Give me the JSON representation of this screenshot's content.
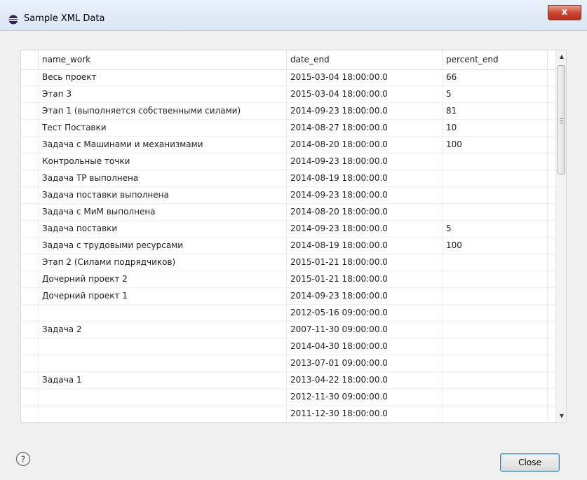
{
  "window": {
    "title": "Sample XML Data",
    "close_glyph": "x"
  },
  "table": {
    "columns": [
      "name_work",
      "date_end",
      "percent_end"
    ],
    "rows": [
      {
        "name_work": "Весь проект",
        "date_end": "2015-03-04 18:00:00.0",
        "percent_end": "66"
      },
      {
        "name_work": "Этап 3",
        "date_end": "2015-03-04 18:00:00.0",
        "percent_end": "5"
      },
      {
        "name_work": "Этап 1 (выполняется собственными силами)",
        "date_end": "2014-09-23 18:00:00.0",
        "percent_end": "81"
      },
      {
        "name_work": "Тест Поставки",
        "date_end": "2014-08-27 18:00:00.0",
        "percent_end": "10"
      },
      {
        "name_work": "Задача с Машинами и механизмами",
        "date_end": "2014-08-20 18:00:00.0",
        "percent_end": "100"
      },
      {
        "name_work": "Контрольные точки",
        "date_end": "2014-09-23 18:00:00.0",
        "percent_end": ""
      },
      {
        "name_work": "Задача ТР выполнена",
        "date_end": "2014-08-19 18:00:00.0",
        "percent_end": ""
      },
      {
        "name_work": "Задача поставки выполнена",
        "date_end": "2014-09-23 18:00:00.0",
        "percent_end": ""
      },
      {
        "name_work": "Задача с МиМ выполнена",
        "date_end": "2014-08-20 18:00:00.0",
        "percent_end": ""
      },
      {
        "name_work": "Задача поставки",
        "date_end": "2014-09-23 18:00:00.0",
        "percent_end": "5"
      },
      {
        "name_work": "Задача с трудовыми ресурсами",
        "date_end": "2014-08-19 18:00:00.0",
        "percent_end": "100"
      },
      {
        "name_work": "Этап 2 (Силами подрядчиков)",
        "date_end": "2015-01-21 18:00:00.0",
        "percent_end": ""
      },
      {
        "name_work": "Дочерний проект 2",
        "date_end": "2015-01-21 18:00:00.0",
        "percent_end": ""
      },
      {
        "name_work": "Дочерний проект 1",
        "date_end": "2014-09-23 18:00:00.0",
        "percent_end": ""
      },
      {
        "name_work": "",
        "date_end": "2012-05-16 09:00:00.0",
        "percent_end": ""
      },
      {
        "name_work": "Задача 2",
        "date_end": "2007-11-30 09:00:00.0",
        "percent_end": ""
      },
      {
        "name_work": "",
        "date_end": "2014-04-30 18:00:00.0",
        "percent_end": ""
      },
      {
        "name_work": "",
        "date_end": "2013-07-01 09:00:00.0",
        "percent_end": ""
      },
      {
        "name_work": "Задача 1",
        "date_end": "2013-04-22 18:00:00.0",
        "percent_end": ""
      },
      {
        "name_work": "",
        "date_end": "2012-11-30 09:00:00.0",
        "percent_end": ""
      },
      {
        "name_work": "",
        "date_end": "2011-12-30 18:00:00.0",
        "percent_end": ""
      }
    ]
  },
  "icons": {
    "app": "eclipse-icon",
    "help": "help-icon",
    "scroll_up": "scroll-up-arrow-icon",
    "scroll_down": "scroll-down-arrow-icon"
  },
  "footer": {
    "close_label": "Close"
  },
  "colors": {
    "titlebar": "#dbe6f4",
    "close_x": "#c7432f",
    "button_border": "#3c7fb1"
  }
}
